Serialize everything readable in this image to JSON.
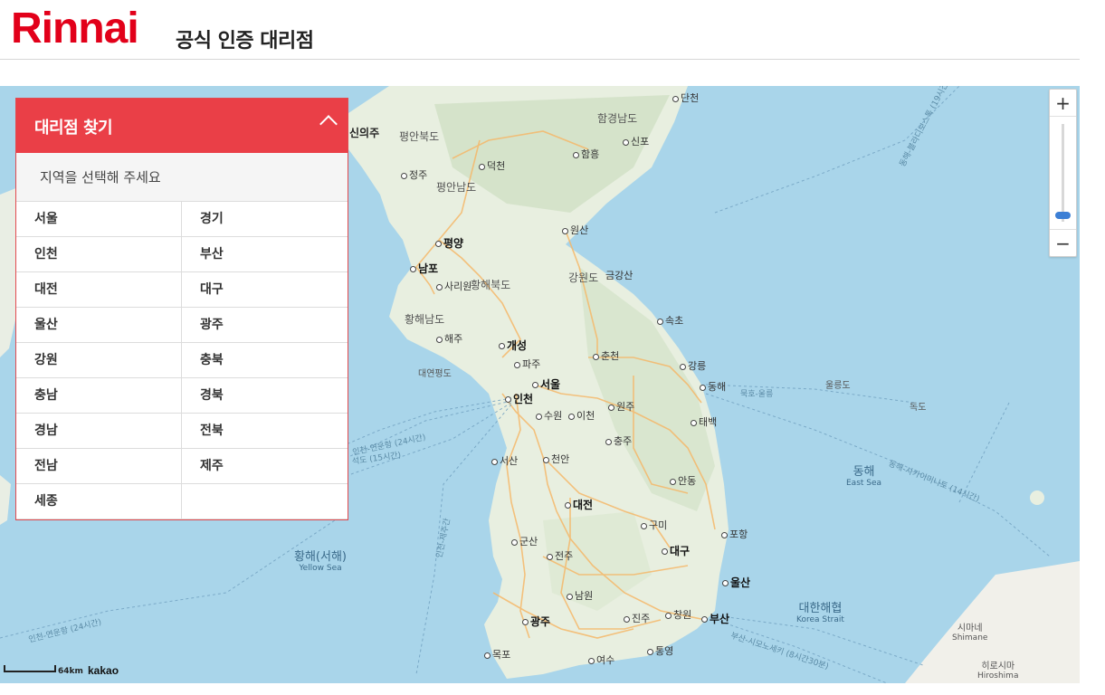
{
  "header": {
    "logo_text": "Rinnai",
    "title": "공식 인증 대리점",
    "brand_color": "#e2001a"
  },
  "panel": {
    "title": "대리점 찾기",
    "prompt": "지역을 선택해 주세요",
    "accent_color": "#ea3f47",
    "regions": [
      "서울",
      "경기",
      "인천",
      "부산",
      "대전",
      "대구",
      "울산",
      "광주",
      "강원",
      "충북",
      "충남",
      "경북",
      "경남",
      "전북",
      "전남",
      "제주",
      "세종",
      ""
    ]
  },
  "map": {
    "provider": "kakao",
    "scale_label": "64km",
    "zoom_in_label": "+",
    "zoom_out_label": "−",
    "labels": {
      "dancheon": "단천",
      "hamgyeong": "함경남도",
      "sinpo": "신포",
      "hamheung": "함흥",
      "sinuiju": "신의주",
      "pyeonganbuk": "평안북도",
      "jeongju": "정주",
      "deokcheon": "덕천",
      "pyeongannam": "평안남도",
      "wonsan": "원산",
      "pyongyang": "평양",
      "nampo": "남포",
      "gangwondo_n": "강원도",
      "geumgangsan": "금강산",
      "sariwon": "사리원",
      "hwanghaebuk": "황해북도",
      "hwanghaenam": "황해남도",
      "sokcho": "속초",
      "haeju": "해주",
      "kaesong": "개성",
      "chuncheon": "춘천",
      "gangneung": "강릉",
      "paju": "파주",
      "yeonpyeong": "대연평도",
      "seoul": "서울",
      "donghae": "동해",
      "incheon": "인천",
      "suwon": "수원",
      "icheon": "이천",
      "wonju": "원주",
      "ulleungdo": "울릉도",
      "dokdo": "독도",
      "taebaek": "태백",
      "chungju": "충주",
      "cheonan": "천안",
      "seosan": "서산",
      "andong": "안동",
      "daejeon": "대전",
      "gumi": "구미",
      "pohang": "포항",
      "gunsan": "군산",
      "daegu": "대구",
      "jeonju": "전주",
      "ulsan": "울산",
      "namwon": "남원",
      "gwangju": "광주",
      "jinju": "진주",
      "changwon": "창원",
      "busan": "부산",
      "mokpo": "목포",
      "yeosu": "여수",
      "tongyeong": "통영",
      "east_sea": "동해",
      "east_sea_en": "East Sea",
      "yellow_sea": "황해(서해)",
      "yellow_sea_en": "Yellow Sea",
      "korea_strait": "대한해협",
      "korea_strait_en": "Korea Strait",
      "shimane": "시마네",
      "shimane_en": "Shimane",
      "hiroshima": "히로시마",
      "hiroshima_en": "Hiroshima",
      "mukho_ulleung": "묵호-울릉",
      "donghae_vlad": "동해-블라디보스톡 (19시간)",
      "donghae_sakai": "동해-사카이미나토 (14시간)",
      "incheon_yantai": "인천-연운항 (24시간)",
      "incheon_shidao": "석도 (15시간)",
      "incheon_jeju": "인천-제주간",
      "incheon_lianyungang_s": "인천-연운항 (24시간)",
      "busan_shimonoseki": "부산-시모노세키 (8시간30분)",
      "hwanghae_left": "해령도"
    }
  }
}
